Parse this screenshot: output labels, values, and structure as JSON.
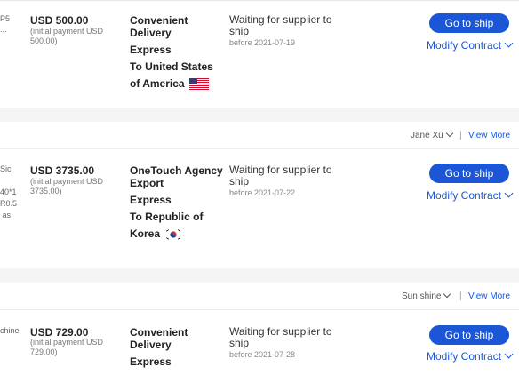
{
  "orders": [
    {
      "left_snippet": "P5\n...",
      "price": "USD 500.00",
      "price_note": "(initial payment USD 500.00)",
      "shipping_company": [
        "Convenient",
        "Delivery"
      ],
      "shipping_method": "Express",
      "destination": [
        "To United States",
        "of America"
      ],
      "flag": "us-flag-icon",
      "status": "Waiting for supplier to ship",
      "deadline": "before 2021-07-19",
      "ship_button": "Go to ship",
      "modify_link": "Modify Contract"
    },
    {
      "left_snippet": "Sic\n\n40*1\nR0.5\n as",
      "price": "USD 3735.00",
      "price_note": "(initial payment USD 3735.00)",
      "shipping_company": [
        "OneTouch Agency",
        "Export"
      ],
      "shipping_method": "Express",
      "destination": [
        "To Republic of",
        "Korea"
      ],
      "flag": "kr-flag-icon",
      "status": "Waiting for supplier to ship",
      "deadline": "before 2021-07-22",
      "ship_button": "Go to ship",
      "modify_link": "Modify Contract"
    },
    {
      "left_snippet": "chine",
      "price": "USD 729.00",
      "price_note": "(initial payment USD 729.00)",
      "shipping_company": [
        "Convenient",
        "Delivery"
      ],
      "shipping_method": "Express",
      "destination": [],
      "status": "Waiting for supplier to ship",
      "deadline": "before 2021-07-28",
      "ship_button": "Go to ship",
      "modify_link": "Modify Contract"
    }
  ],
  "order_headers": [
    {
      "contact": "Jane Xu",
      "separator": "|",
      "view_more": "View More"
    },
    {
      "contact": "Sun shine",
      "separator": "|",
      "view_more": "View More"
    }
  ],
  "colors": {
    "accent": "#1a56d6",
    "band": "#f5f5f5"
  }
}
